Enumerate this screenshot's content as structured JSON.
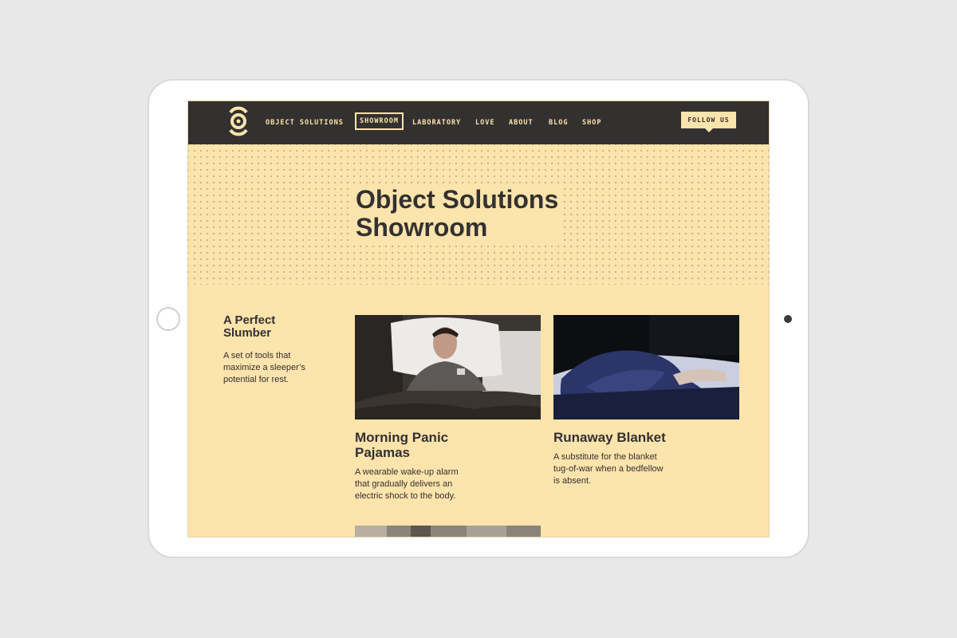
{
  "nav": {
    "items": [
      {
        "label": "OBJECT SOLUTIONS"
      },
      {
        "label": "SHOWROOM"
      },
      {
        "label": "LABORATORY"
      },
      {
        "label": "LOVE"
      },
      {
        "label": "ABOUT"
      },
      {
        "label": "BLOG"
      },
      {
        "label": "SHOP"
      }
    ],
    "follow_label": "FOLLOW US"
  },
  "hero": {
    "title_line1": "Object Solutions",
    "title_line2": "Showroom"
  },
  "intro": {
    "title_line1": "A Perfect",
    "title_line2": "Slumber",
    "desc_lines": [
      "A set of tools that",
      "maximize a sleeper’s",
      "potential for rest."
    ]
  },
  "products": [
    {
      "title_line1": "Morning Panic",
      "title_line2": "Pajamas",
      "desc_lines": [
        "A wearable wake-up alarm",
        "that gradually delivers an",
        "electric shock to the body."
      ],
      "image": "man-sleeping-photo"
    },
    {
      "title_line1": "Runaway Blanket",
      "title_line2": "",
      "desc_lines": [
        "A substitute for the blanket",
        "tug-of-war when a bedfellow",
        "is absent."
      ],
      "image": "blanket-bed-photo"
    }
  ],
  "colors": {
    "background": "#fde3ac",
    "navbar": "#333130",
    "text": "#333130",
    "page": "#e8e8e8"
  }
}
